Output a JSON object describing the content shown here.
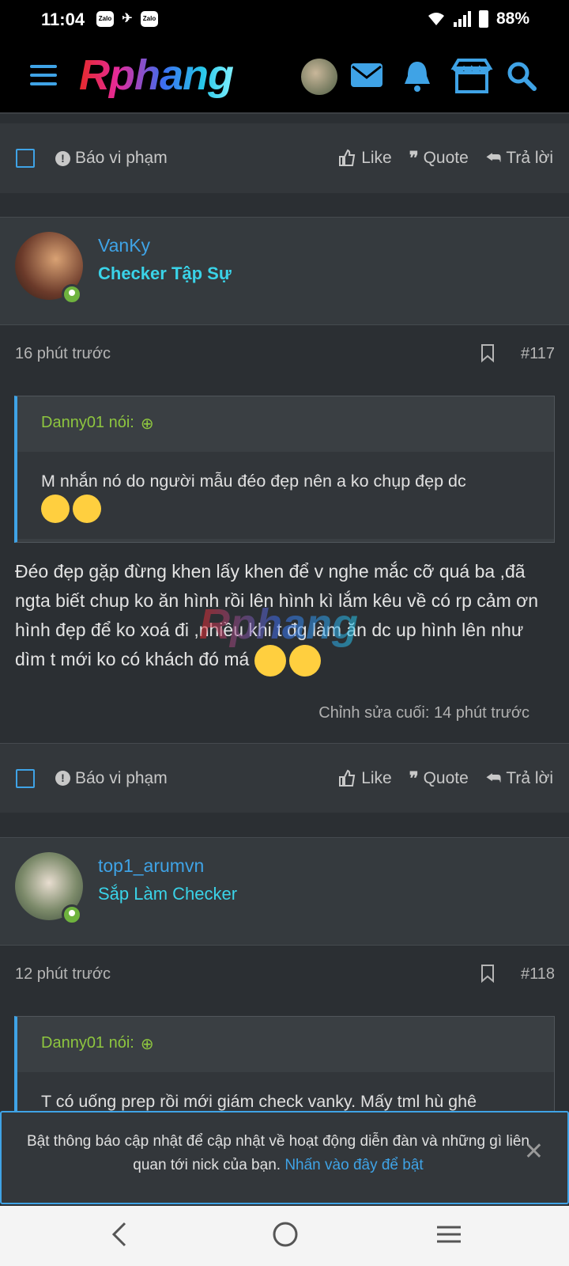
{
  "status": {
    "time": "11:04",
    "battery": "88%",
    "apps": [
      "Zalo",
      "Zalo"
    ]
  },
  "nav": {
    "logo": "Rphang"
  },
  "action_bar": {
    "report": "Báo vi phạm",
    "like": "Like",
    "quote": "Quote",
    "reply": "Trả lời"
  },
  "posts": [
    {
      "username": "VanKy",
      "rank": "Checker Tập Sự",
      "time": "16 phút trước",
      "number": "#117",
      "quote_author": "Danny01 nói:",
      "quote_text": "M nhắn nó do người mẫu đéo đẹp nên a ko chụp đẹp dc",
      "body": "Đéo đẹp gặp đừng khen lấy khen để v nghe mắc cỡ quá ba ,đã ngta biết chup ko ăn hình rồi lên hình kì lắm kêu về có rp cảm ơn hình đẹp để ko xoá đi ,nhiều khi t đg làm ăn dc up hình lên như dìm t mới ko có khách đó má",
      "edited": "Chỉnh sửa cuối: 14 phút trước"
    },
    {
      "username": "top1_arumvn",
      "rank": "Sắp Làm Checker",
      "time": "12 phút trước",
      "number": "#118",
      "quote_author": "Danny01 nói:",
      "quote_text": "T có uống prep rồi mới giám check vanky. Mấy tml hù ghê"
    }
  ],
  "notification": {
    "text": "Bật thông báo cập nhật để cập nhật về hoạt động diễn đàn và những gì liên quan tới nick của bạn.",
    "link": "Nhấn vào đây để bật"
  },
  "colors": {
    "accent": "#3fa3e6",
    "rank": "#3ad3e8",
    "quote_author": "#8ec63f",
    "background": "#2b2f33"
  }
}
